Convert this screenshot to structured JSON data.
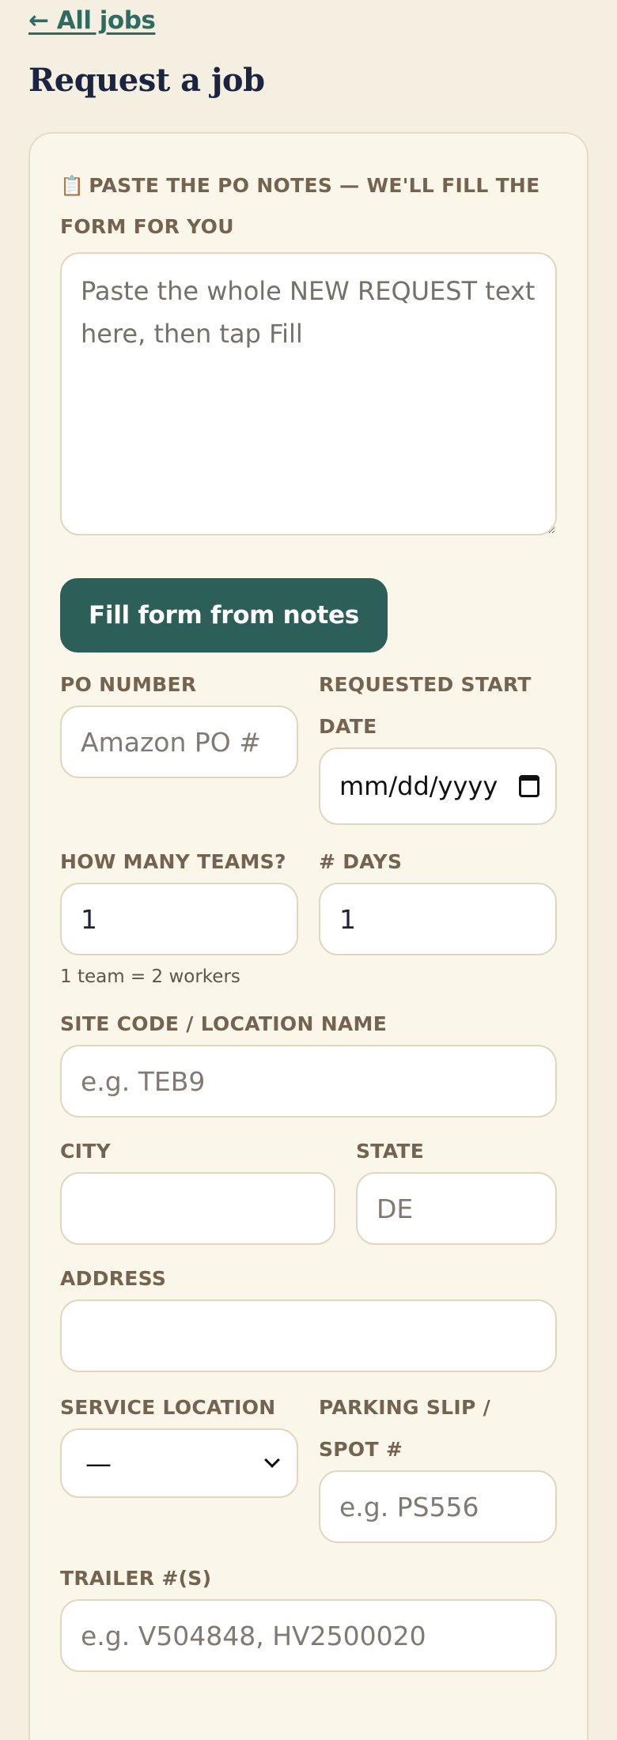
{
  "nav": {
    "back_label": "← All jobs"
  },
  "page": {
    "title": "Request a job"
  },
  "form": {
    "notes": {
      "icon": "📋",
      "label": "PASTE THE PO NOTES — WE'LL FILL THE FORM FOR YOU",
      "placeholder": "Paste the whole NEW REQUEST text here, then tap Fill",
      "value": ""
    },
    "fill_button_label": "Fill form from notes",
    "po_number": {
      "label": "PO NUMBER",
      "placeholder": "Amazon PO #",
      "value": ""
    },
    "start_date": {
      "label": "REQUESTED START DATE",
      "value": "mm/dd/yyyy"
    },
    "teams": {
      "label": "HOW MANY TEAMS?",
      "value": "1",
      "hint": "1 team = 2 workers"
    },
    "days": {
      "label": "# DAYS",
      "value": "1"
    },
    "site_code": {
      "label": "SITE CODE / LOCATION NAME",
      "placeholder": "e.g. TEB9",
      "value": ""
    },
    "city": {
      "label": "CITY",
      "placeholder": "",
      "value": ""
    },
    "state": {
      "label": "STATE",
      "placeholder": "DE",
      "value": ""
    },
    "address": {
      "label": "ADDRESS",
      "placeholder": "",
      "value": ""
    },
    "service_location": {
      "label": "SERVICE LOCATION",
      "selected": "—"
    },
    "parking_slip": {
      "label": "PARKING SLIP / SPOT #",
      "placeholder": "e.g. PS556",
      "value": ""
    },
    "trailers": {
      "label": "TRAILER #(S)",
      "placeholder": "e.g. V504848, HV2500020",
      "value": ""
    }
  }
}
